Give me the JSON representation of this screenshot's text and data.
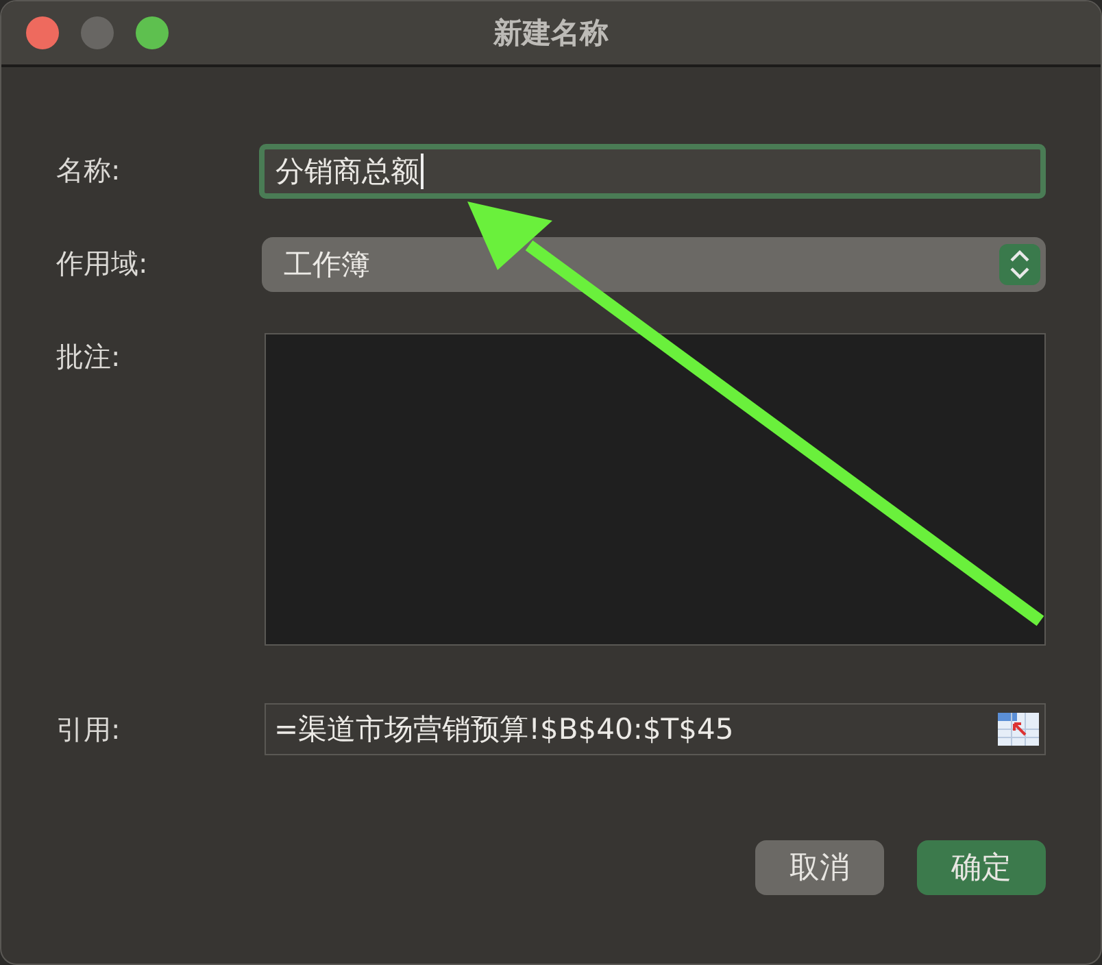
{
  "window": {
    "title": "新建名称"
  },
  "fields": [
    {
      "kind": "text",
      "label": "名称:",
      "value": "分销商总额",
      "focused": true
    },
    {
      "kind": "select",
      "label": "作用域:",
      "value": "工作簿"
    },
    {
      "kind": "area",
      "label": "批注:"
    },
    {
      "kind": "reference",
      "label": "引用:",
      "value": "=渠道市场营销预算!$B$40:$T$45"
    }
  ],
  "buttons": [
    {
      "label": "取消",
      "default": false
    },
    {
      "label": "确定",
      "default": true
    }
  ],
  "annotation": {
    "kind": "arrow"
  }
}
